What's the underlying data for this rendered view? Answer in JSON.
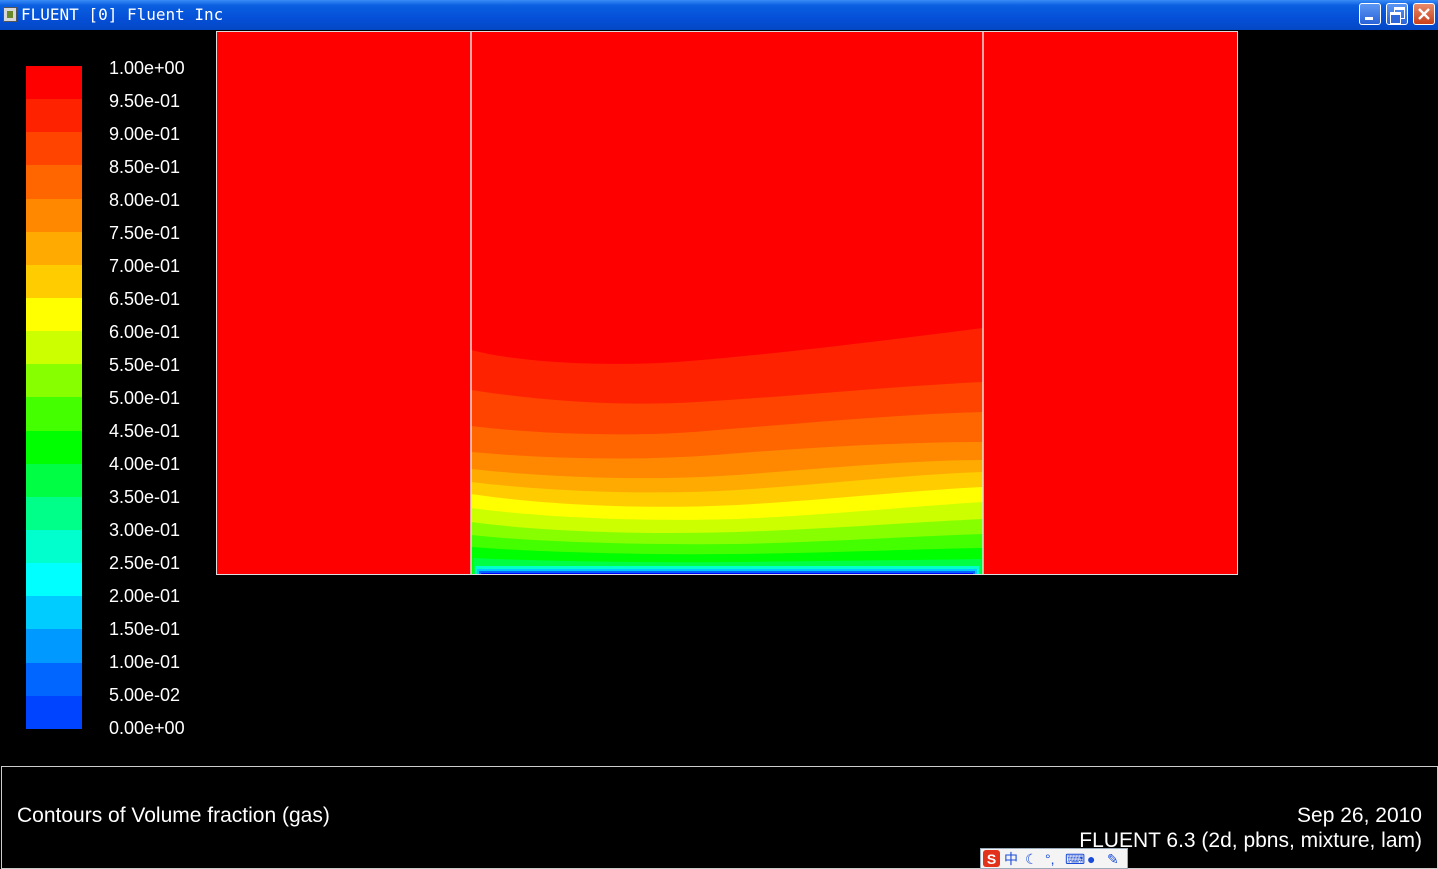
{
  "window": {
    "title": "FLUENT [0] Fluent Inc"
  },
  "legend": {
    "labels": [
      "1.00e+00",
      "9.50e-01",
      "9.00e-01",
      "8.50e-01",
      "8.00e-01",
      "7.50e-01",
      "7.00e-01",
      "6.50e-01",
      "6.00e-01",
      "5.50e-01",
      "5.00e-01",
      "4.50e-01",
      "4.00e-01",
      "3.50e-01",
      "3.00e-01",
      "2.50e-01",
      "2.00e-01",
      "1.50e-01",
      "1.00e-01",
      "5.00e-02",
      "0.00e+00"
    ],
    "colors": [
      "#ff0000",
      "#ff2200",
      "#ff4400",
      "#ff6600",
      "#ff8800",
      "#ffaa00",
      "#ffcc00",
      "#ffff00",
      "#ccff00",
      "#88ff00",
      "#44ff00",
      "#00ff00",
      "#00ff44",
      "#00ff88",
      "#00ffcc",
      "#00ffff",
      "#00ccff",
      "#0099ff",
      "#0066ff",
      "#0044ff",
      "#0000ff"
    ]
  },
  "info": {
    "title": "Contours of Volume fraction (gas)",
    "date": "Sep 26, 2010",
    "version": "FLUENT 6.3 (2d, pbns, mixture, lam)"
  },
  "taskbar": {
    "ime_logo": "S",
    "ime_mode": "中"
  }
}
